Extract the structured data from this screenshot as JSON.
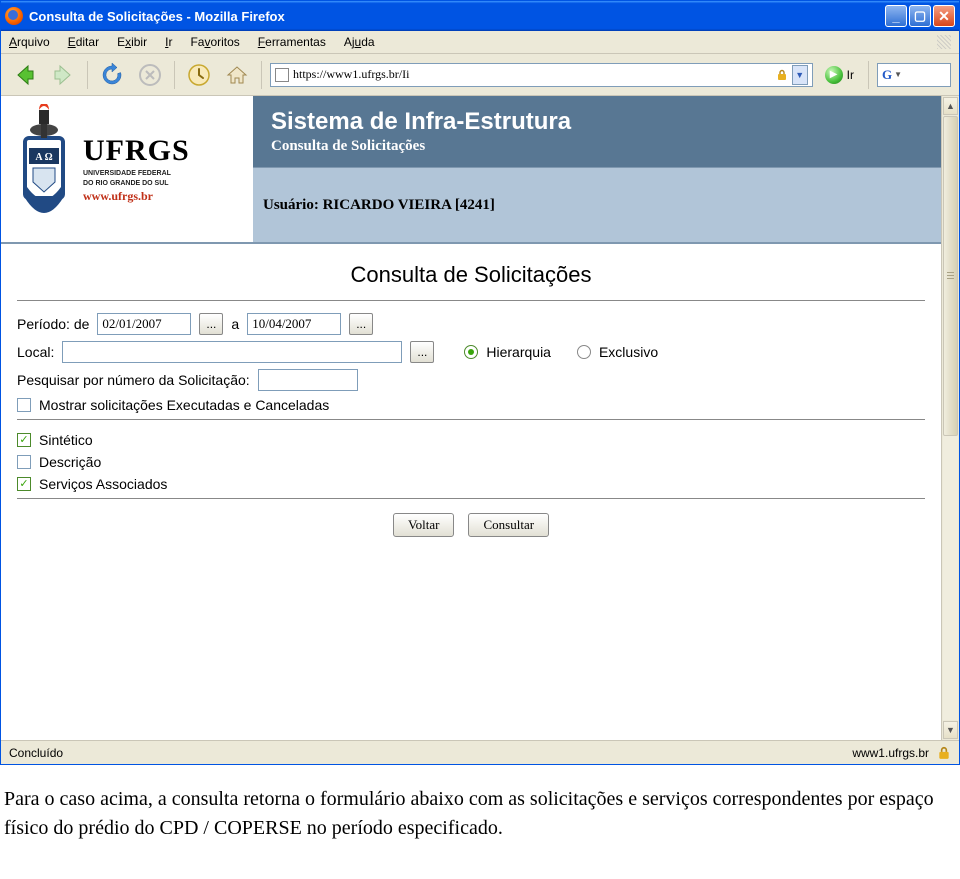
{
  "window": {
    "title": "Consulta de Solicitações - Mozilla Firefox"
  },
  "menubar": {
    "arquivo": "Arquivo",
    "editar": "Editar",
    "exibir": "Exibir",
    "ir": "Ir",
    "favoritos": "Favoritos",
    "ferramentas": "Ferramentas",
    "ajuda": "Ajuda"
  },
  "toolbar": {
    "address": "https://www1.ufrgs.br/Ii",
    "go_label": "Ir",
    "search_engine": "G"
  },
  "logo": {
    "text": "UFRGS",
    "sub1": "UNIVERSIDADE FEDERAL",
    "sub2": "DO RIO GRANDE DO SUL",
    "url": "www.ufrgs.br"
  },
  "header": {
    "system_title": "Sistema de Infra-Estrutura",
    "system_sub": "Consulta de Solicitações",
    "user_label": "Usuário: RICARDO VIEIRA [4241]"
  },
  "form": {
    "title": "Consulta de Solicitações",
    "period_label": "Período:  de",
    "period_a": "a",
    "date_from": "02/01/2007",
    "date_to": "10/04/2007",
    "ellipsis": "...",
    "local_label": "Local:",
    "hierarquia_label": "Hierarquia",
    "exclusivo_label": "Exclusivo",
    "search_num_label": "Pesquisar por número da Solicitação:",
    "show_exec_label": "Mostrar solicitações Executadas e Canceladas",
    "sintetico_label": "Sintético",
    "descricao_label": "Descrição",
    "servicos_label": "Serviços Associados",
    "voltar": "Voltar",
    "consultar": "Consultar",
    "sintetico_checked": true,
    "descricao_checked": false,
    "servicos_checked": true,
    "show_exec_checked": false,
    "hierarquia_selected": true
  },
  "statusbar": {
    "left": "Concluído",
    "right": "www1.ufrgs.br"
  },
  "footer_text": "Para o caso acima, a consulta retorna o formulário abaixo com as solicitações e serviços correspondentes por espaço físico do prédio do CPD / COPERSE no período especificado."
}
